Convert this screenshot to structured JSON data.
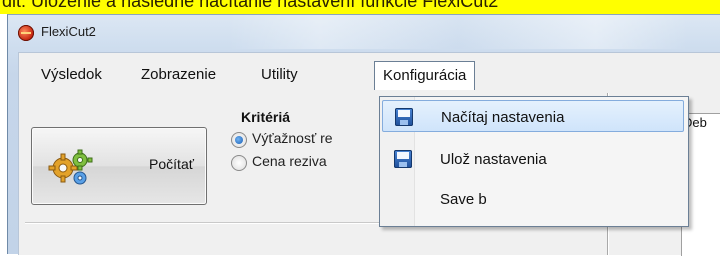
{
  "caption": "dit: Uloženie a následné načítanie nastavení funkcie FlexiCut2",
  "window": {
    "title": "FlexiCut2",
    "icon": "app-logo-icon"
  },
  "menu": {
    "items": [
      "Výsledok",
      "Zobrazenie",
      "Utility",
      "Konfigurácia"
    ],
    "open": "Konfigurácia"
  },
  "main": {
    "compute_label": "Počítať",
    "compute_icon": "gears-icon",
    "criteria_title": "Kritériá",
    "radios": [
      {
        "label": "Výťažnosť re",
        "checked": true
      },
      {
        "label": "Cena reziva",
        "checked": false
      }
    ],
    "right_label": "Deb"
  },
  "dropdown": {
    "items": [
      {
        "label": "Načítaj nastavenia",
        "icon": "floppy-disk-icon",
        "highlighted": true
      },
      {
        "label": "Ulož nastavenia",
        "icon": "floppy-disk-icon",
        "highlighted": false
      },
      {
        "label": "Save b",
        "icon": "",
        "highlighted": false
      }
    ]
  },
  "colors": {
    "caption_bg": "#ffff00",
    "highlight": "#cfe4fb",
    "radio_checked": "#1b5fb5"
  }
}
